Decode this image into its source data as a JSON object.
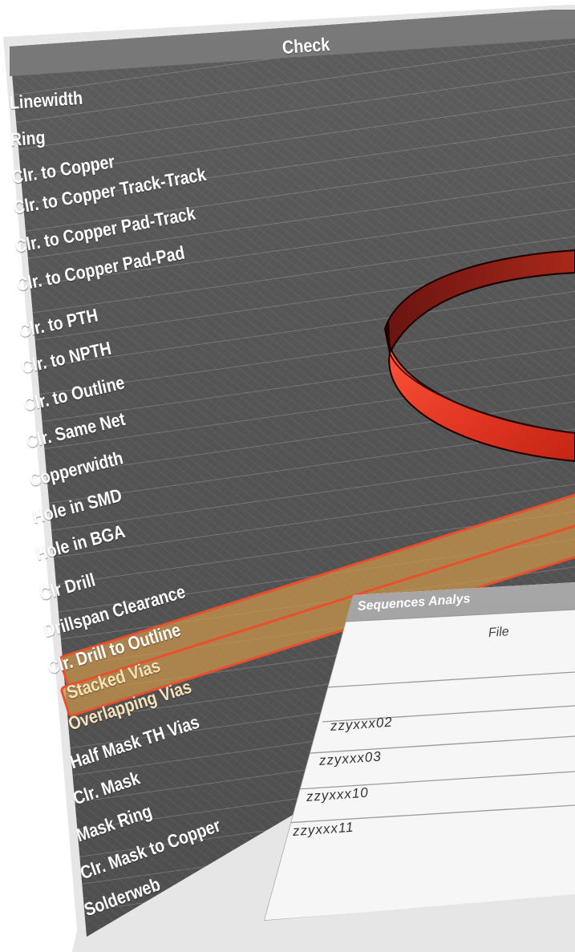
{
  "check_panel": {
    "header": "Check",
    "items": [
      {
        "label": "Linewidth"
      },
      {
        "label": "Ring"
      },
      {
        "label": "Clr. to Copper"
      },
      {
        "label": "Clr. to Copper Track-Track"
      },
      {
        "label": "Clr. to Copper Pad-Track"
      },
      {
        "label": "Clr. to Copper Pad-Pad"
      },
      {
        "label": "Clr. to PTH"
      },
      {
        "label": "Clr. to NPTH"
      },
      {
        "label": "Clr. to Outline"
      },
      {
        "label": "Clr. Same Net"
      },
      {
        "label": "Copperwidth"
      },
      {
        "label": "Hole in SMD"
      },
      {
        "label": "Hole in BGA"
      },
      {
        "label": "Clr Drill"
      },
      {
        "label": "Drillspan Clearance"
      },
      {
        "label": "Clr. Drill to Outline"
      },
      {
        "label": "Stacked Vias",
        "highlighted": true
      },
      {
        "label": "Overlapping Vias",
        "highlighted": true
      },
      {
        "label": "Half Mask TH Vias"
      },
      {
        "label": "Clr. Mask"
      },
      {
        "label": "Mask Ring"
      },
      {
        "label": "Clr. Mask to Copper"
      },
      {
        "label": "Solderweb"
      }
    ]
  },
  "sequences_panel": {
    "title": "Sequences Analys",
    "column_header": "File",
    "rows": [
      "zzyxxx02",
      "zzyxxx03",
      "zzyxxx10",
      "zzyxxx11"
    ]
  },
  "colors": {
    "panel_dark": "#555555",
    "highlight_fill": "#cd964b",
    "highlight_border": "#e8502d",
    "ring_red": "#d83a26"
  }
}
